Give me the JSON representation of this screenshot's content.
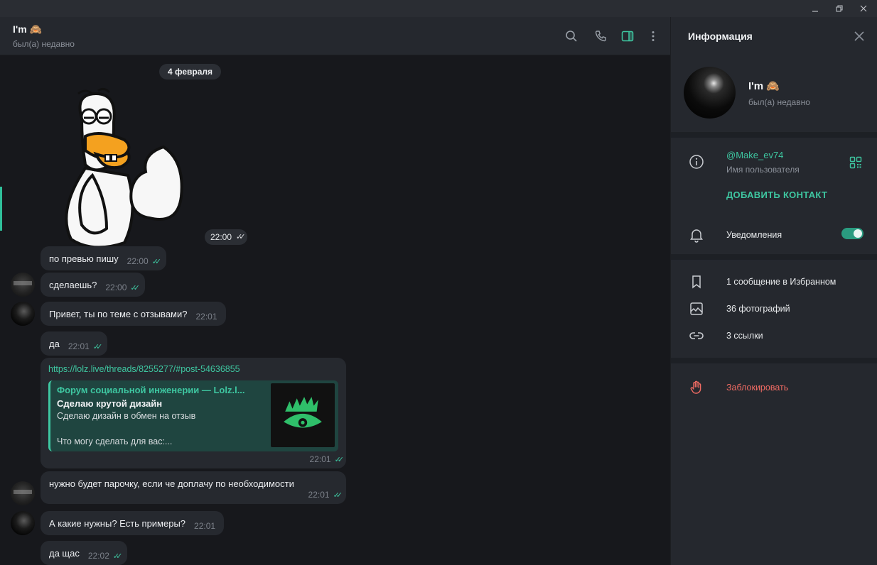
{
  "window": {
    "controls": [
      "minimize",
      "restore",
      "close"
    ]
  },
  "chat": {
    "name": "I'm 🙈",
    "status": "был(а) недавно",
    "header_icons": [
      "search-icon",
      "phone-icon",
      "sidebar-toggle-icon",
      "more-vertical-icon"
    ]
  },
  "messages": {
    "date": "4 февраля",
    "sticker_time": "22:00",
    "m1": {
      "text": "по превью пишу",
      "time": "22:00"
    },
    "m2": {
      "text": "сделаешь?",
      "time": "22:00"
    },
    "m3": {
      "text": "Привет, ты по теме с отзывами?",
      "time": "22:01"
    },
    "m4": {
      "text": "да",
      "time": "22:01"
    },
    "link": {
      "url": "https://lolz.live/threads/8255277/#post-54636855",
      "site": "Форум социальной инженерии — Lolz.l...",
      "title": "Сделаю крутой дизайн",
      "desc1": "Сделаю дизайн в обмен на отзыв",
      "desc2": "Что могу сделать для вас:...",
      "time": "22:01"
    },
    "m5": {
      "text": "нужно будет парочку, если че доплачу по необходимости",
      "time": "22:01"
    },
    "m6": {
      "text": "А какие нужны? Есть примеры?",
      "time": "22:01"
    },
    "m7": {
      "text": "да щас",
      "time": "22:02"
    }
  },
  "info": {
    "title": "Информация",
    "name": "I'm 🙈",
    "status": "был(а) недавно",
    "username": "@Make_ev74",
    "username_label": "Имя пользователя",
    "add_contact": "ДОБАВИТЬ КОНТАКТ",
    "notifications": "Уведомления",
    "notifications_on": true,
    "saved": "1 сообщение в Избранном",
    "photos": "36 фотографий",
    "links": "3 ссылки",
    "block": "Заблокировать"
  },
  "colors": {
    "accent": "#3ec7a1",
    "danger": "#f06b63",
    "bubble": "#26292f",
    "background": "#17181c",
    "panel": "#25282e"
  }
}
